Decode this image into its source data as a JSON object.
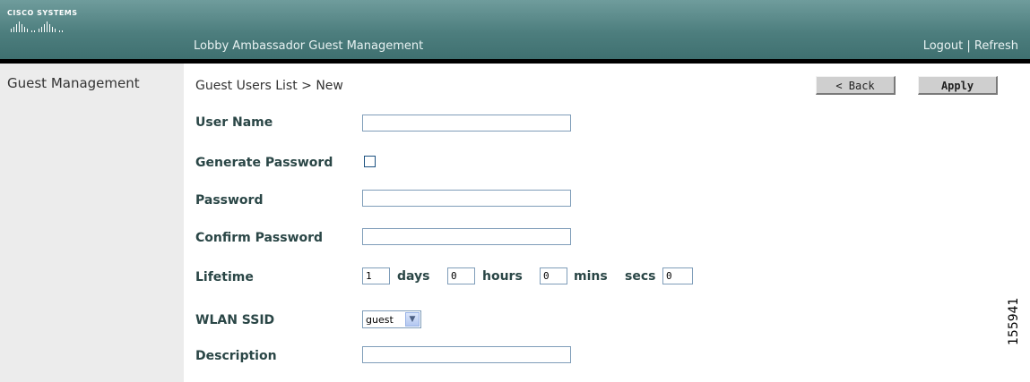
{
  "brand": {
    "logo_text": "Cisco Systems"
  },
  "header": {
    "app_title": "Lobby Ambassador Guest Management",
    "logout": "Logout",
    "separator": "|",
    "refresh": "Refresh"
  },
  "sidebar": {
    "items": [
      {
        "label": "Guest Management"
      }
    ]
  },
  "breadcrumb": "Guest Users List > New",
  "buttons": {
    "back": "< Back",
    "apply": "Apply"
  },
  "form": {
    "user_name": {
      "label": "User Name",
      "value": ""
    },
    "generate_password": {
      "label": "Generate Password",
      "checked": false
    },
    "password": {
      "label": "Password",
      "value": ""
    },
    "confirm_password": {
      "label": "Confirm Password",
      "value": ""
    },
    "lifetime": {
      "label": "Lifetime",
      "days_value": "1",
      "days_label": "days",
      "hours_value": "0",
      "hours_label": "hours",
      "mins_value": "0",
      "mins_label": "mins",
      "secs_label": "secs",
      "secs_value": "0"
    },
    "wlan_ssid": {
      "label": "WLAN SSID",
      "selected": "guest"
    },
    "description": {
      "label": "Description",
      "value": ""
    }
  },
  "figure_id": "155941",
  "colors": {
    "header": "#4d7e7e",
    "label": "#2a4646",
    "sidebar": "#ececec"
  }
}
